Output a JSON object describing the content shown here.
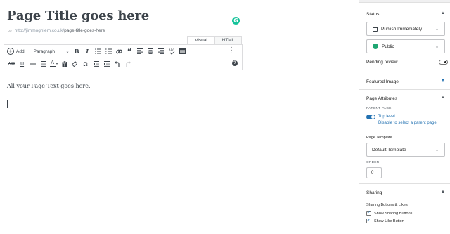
{
  "editor": {
    "title": "Page Title goes here",
    "permalink_base": "http://jimmoghlem.co.uk/",
    "permalink_slug": "page-title-goes-here",
    "grammarly_badge": "G",
    "tabs": [
      {
        "label": "Visual",
        "active": true
      },
      {
        "label": "HTML",
        "active": false
      }
    ],
    "toolbar": {
      "add_label": "Add",
      "format_select": "Paragraph",
      "bold": "B",
      "italic": "I",
      "row1_icons": [
        "bullet-list-icon",
        "numbered-list-icon",
        "link-icon",
        "blockquote-icon",
        "align-left-icon",
        "align-center-icon",
        "align-right-icon",
        "spellcheck-icon",
        "table-icon"
      ],
      "strike": "ABC",
      "underline": "U",
      "row2_icons": [
        "horizontal-rule-icon",
        "justify-icon",
        "text-color-icon",
        "paste-text-icon",
        "clear-formatting-icon",
        "special-character-icon",
        "outdent-icon",
        "indent-icon",
        "undo-icon",
        "redo-icon",
        "help-icon"
      ],
      "text_color_glyph": "A",
      "omega": "Ω",
      "help_glyph": "?"
    },
    "content_text": "All your Page Text goes here."
  },
  "sidebar": {
    "status": {
      "heading": "Status",
      "publish_select": "Publish Immediately",
      "visibility_select": "Public",
      "pending_review": "Pending review",
      "pending_review_on": false
    },
    "featured_image": {
      "heading": "Featured Image"
    },
    "page_attributes": {
      "heading": "Page Attributes",
      "parent_page_caption": "PARENT PAGE",
      "top_level": "Top level",
      "top_level_on": true,
      "disable_hint": "Disable to select a parent page",
      "template_label": "Page Template",
      "template_select": "Default Template",
      "order_caption": "ORDER",
      "order_value": "0"
    },
    "sharing": {
      "heading": "Sharing",
      "sublabel": "Sharing Buttons & Likes",
      "show_sharing": "Show Sharing Buttons",
      "show_like": "Show Like Button",
      "show_sharing_checked": true,
      "show_like_checked": true
    }
  },
  "colors": {
    "accent": "#2271b1",
    "grammarly": "#15c39a",
    "globe": "#1ea672"
  }
}
